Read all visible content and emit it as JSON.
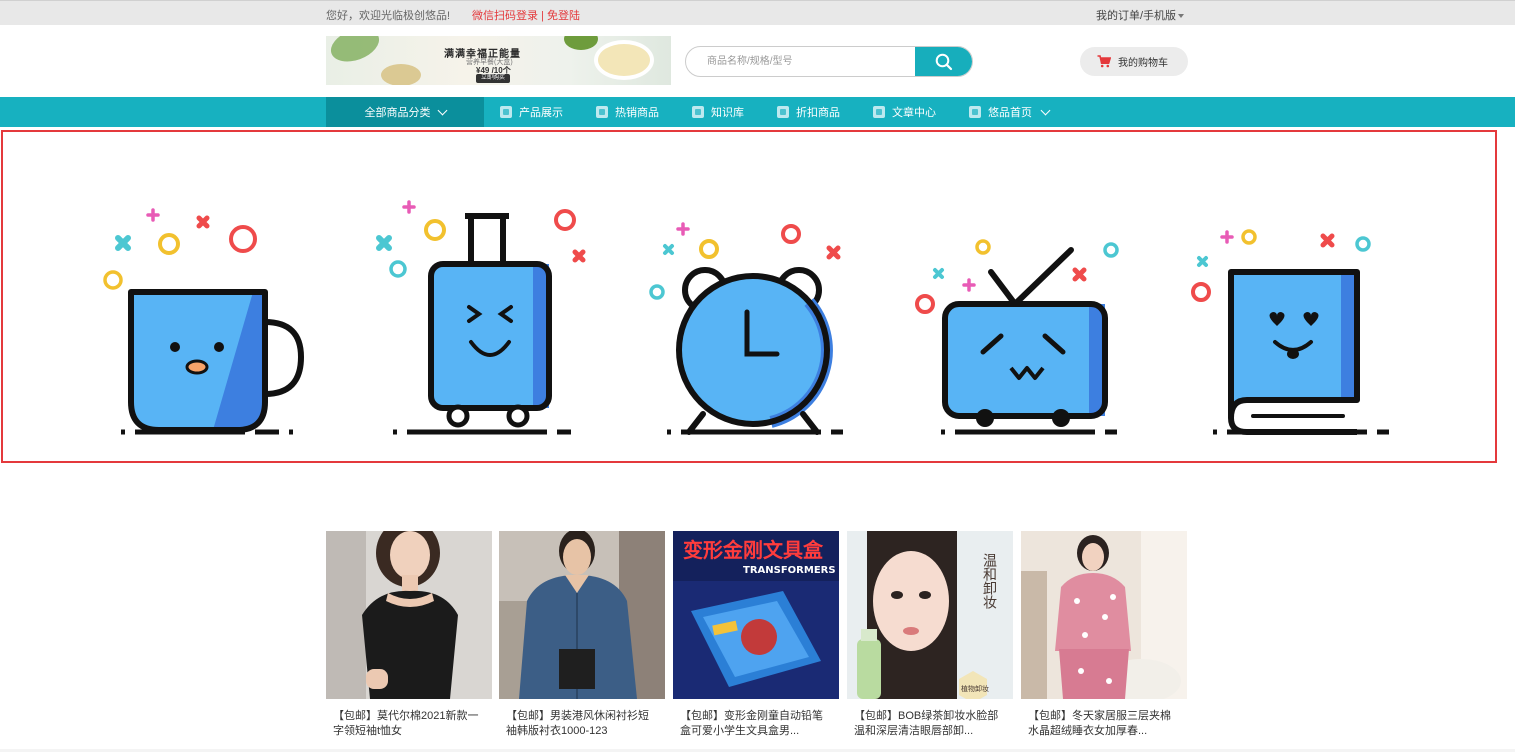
{
  "topbar": {
    "greeting": "您好，欢迎光临极创悠品!",
    "wechat_login": "微信扫码登录",
    "separator": " | ",
    "register": "免登陆",
    "orders": "我的订单/手机版"
  },
  "banner": {
    "headline": "满满幸福正能量",
    "subline": "营养早餐(大盒)",
    "price": "¥49 /10个",
    "cta": "立即购买"
  },
  "search": {
    "placeholder": "商品名称/规格/型号"
  },
  "cart": {
    "label": "我的购物车"
  },
  "nav": {
    "all_categories": "全部商品分类",
    "items": [
      {
        "label": "产品展示"
      },
      {
        "label": "热销商品"
      },
      {
        "label": "知识库"
      },
      {
        "label": "折扣商品"
      },
      {
        "label": "文章中心"
      },
      {
        "label": "悠品首页"
      }
    ]
  },
  "icons": [
    "mug-icon",
    "suitcase-icon",
    "alarm-clock-icon",
    "tv-icon",
    "book-icon"
  ],
  "colors": {
    "accent": "#17b1c0",
    "accent_dark": "#0b8f9c",
    "link_red": "#e4393c",
    "icon_blue": "#58b4f5"
  },
  "products": [
    {
      "title": "【包邮】莫代尔棉2021新款一字领短袖t恤女"
    },
    {
      "title": "【包邮】男装港风休闲衬衫短袖韩版衬衣1000-123"
    },
    {
      "title": "【包邮】变形金刚童自动铅笔盒可爱小学生文具盒男..."
    },
    {
      "title": "【包邮】BOB绿茶卸妆水脸部温和深层清洁眼唇部卸..."
    },
    {
      "title": "【包邮】冬天家居服三层夹棉水晶超绒睡衣女加厚春..."
    }
  ],
  "product_image_text": {
    "p3_big": "变形金刚文具盒",
    "p3_en": "TRANSFORMERS",
    "p4_side": "温和卸妆",
    "p4_badge": "植物卸妆"
  }
}
